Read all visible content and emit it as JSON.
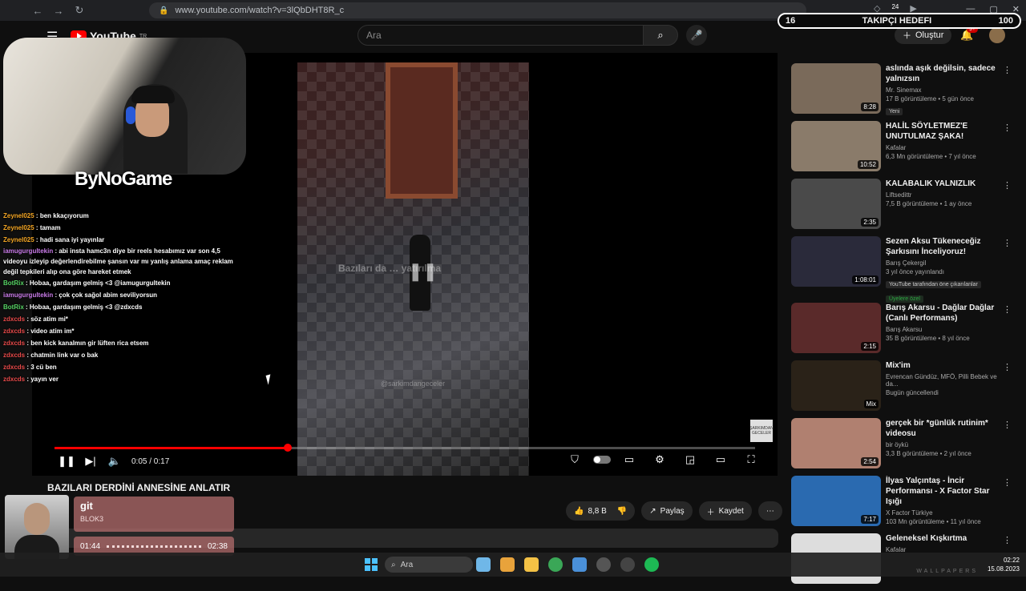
{
  "browser": {
    "url": "www.youtube.com/watch?v=3lQbDHT8R_c",
    "back": "←",
    "forward": "→",
    "reload": "↻",
    "ext_badge": "24",
    "window_min": "—",
    "window_max": "▢",
    "window_close": "✕"
  },
  "youtube": {
    "logo": "YouTube",
    "region": "TR",
    "search_placeholder": "Ara",
    "create_label": "Oluştur",
    "notif_badge": "9+"
  },
  "goal": {
    "current": "16",
    "label": "TAKIPÇI HEDEFI",
    "target": "100"
  },
  "stream": {
    "brand": "ByNoGame"
  },
  "chat": [
    {
      "user": "Zeynel025",
      "msg": " : ben kkaçıyorum",
      "cls": "u1"
    },
    {
      "user": "Zeynel025",
      "msg": " : tamam",
      "cls": "u1"
    },
    {
      "user": "Zeynel025",
      "msg": " : hadi sana iyi yayınlar",
      "cls": "u1"
    },
    {
      "user": "iamugurgultekin",
      "msg": " : abi insta hamc3n diye bir reels hesabımız var son 4,5 videoyu izleyip değerlendirebilme şansın var mı yanlış anlama amaç reklam değil tepkileri alıp ona göre hareket etmek",
      "cls": "u2"
    },
    {
      "user": "BotRix",
      "msg": " : Hobaa, gardaşım gelmiş <3 @iamugurgultekin",
      "cls": "u3"
    },
    {
      "user": "iamugurgultekin",
      "msg": " : çok çok sağol abim seviliyorsun",
      "cls": "u2"
    },
    {
      "user": "BotRix",
      "msg": " : Hobaa, gardaşım gelmiş <3 @zdxcds",
      "cls": "u3"
    },
    {
      "user": "zdxcds",
      "msg": " : söz atim mi*",
      "cls": "u4"
    },
    {
      "user": "zdxcds",
      "msg": " : video atim im*",
      "cls": "u4"
    },
    {
      "user": "zdxcds",
      "msg": " : ben kick kanalmın gir lüften rica etsem",
      "cls": "u4"
    },
    {
      "user": "zdxcds",
      "msg": " : chatmin link var o bak",
      "cls": "u4"
    },
    {
      "user": "zdxcds",
      "msg": " : 3 cü ben",
      "cls": "u4"
    },
    {
      "user": "zdxcds",
      "msg": " : yayın ver",
      "cls": "u4"
    }
  ],
  "player": {
    "overlay_text": "Bazıları da … yatırılma",
    "watermark": "@sarkimdangeceler",
    "corner_logo": "ŞARKIMDAN GECELER",
    "time": "0:05 / 0:17",
    "progress": 0.333
  },
  "video": {
    "title": "BAZILARI DERDİNİ ANNESİNE ANLATIR",
    "likes": "8,8 B",
    "share": "Paylaş",
    "save": "Kaydet"
  },
  "music": {
    "title": "git",
    "artist": "BLOK3",
    "elapsed": "01:44",
    "total": "02:38"
  },
  "recommendations": [
    {
      "title": "aslında aşık değilsin, sadece yalnızsın",
      "channel": "Mr. Sinemax",
      "views": "17 B görüntüleme • 5 gün önce",
      "badge": "Yeni",
      "duration": "8:28",
      "color": "#7a6a5a"
    },
    {
      "title": "HALİL SÖYLETMEZ'E UNUTULMAZ ŞAKA!",
      "channel": "Kafalar",
      "views": "6,3 Mn görüntüleme • 7 yıl önce",
      "duration": "10:52",
      "color": "#8a7b6a"
    },
    {
      "title": "KALABALIK YALNIZLIK",
      "channel": "Liftsedittr",
      "views": "7,5 B görüntüleme • 1 ay önce",
      "duration": "2:35",
      "color": "#4a4a4a"
    },
    {
      "title": "Sezen Aksu Tükeneceğiz Şarkısını İnceliyoruz!",
      "channel": "Barış Çekergil",
      "views": "3 yıl önce yayınlandı",
      "badge": "YouTube tarafından öne çıkarılanlar",
      "badge2": "Üyelere özel",
      "duration": "1:08:01",
      "color": "#2a2a3a"
    },
    {
      "title": "Barış Akarsu - Dağlar Dağlar (Canlı Performans)",
      "channel": "Barış Akarsu",
      "views": "35 B görüntüleme • 8 yıl önce",
      "duration": "2:15",
      "color": "#5a2a2a"
    },
    {
      "title": "Mix'im",
      "channel": "Evrencan Gündüz, MFÖ, Pilli Bebek ve da...",
      "views": "Bugün güncellendi",
      "duration": "Mix",
      "color": "#2a2218"
    },
    {
      "title": "gerçek bir *günlük rutinim* videosu",
      "channel": "bir öykü",
      "views": "3,3 B görüntüleme • 2 yıl önce",
      "duration": "2:54",
      "color": "#b08070"
    },
    {
      "title": "İlyas Yalçıntaş - İncir Performansı - X Factor Star Işığı",
      "channel": "X Factor Türkiye",
      "views": "103 Mn görüntüleme • 11 yıl önce",
      "duration": "7:17",
      "color": "#2a6ab0"
    },
    {
      "title": "Geleneksel Kışkırtma",
      "channel": "Kafalar",
      "views": "",
      "duration": "",
      "color": "#ddd"
    }
  ],
  "taskbar": {
    "search": "Ara",
    "time": "02:22",
    "date": "15.08.2023",
    "watermark": "WALLPAPERS"
  }
}
